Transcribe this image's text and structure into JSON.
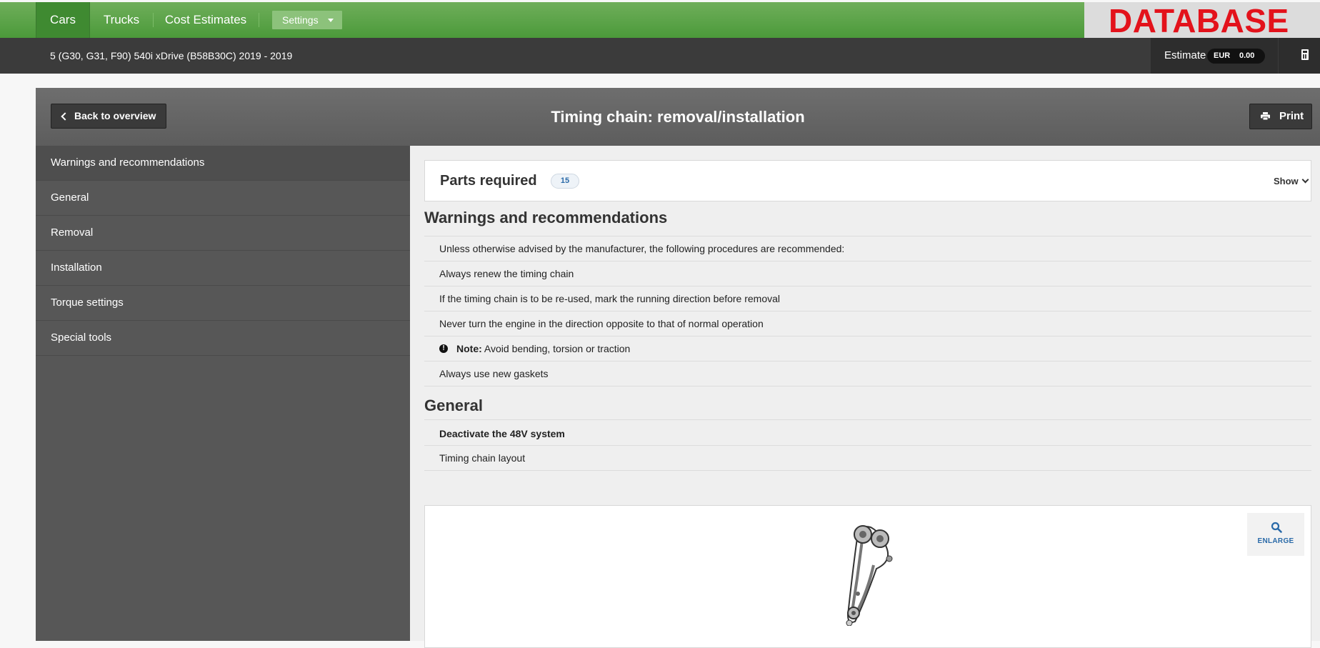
{
  "top_nav": {
    "tabs": [
      {
        "label": "Cars",
        "active": true
      },
      {
        "label": "Trucks",
        "active": false
      },
      {
        "label": "Cost Estimates",
        "active": false
      }
    ],
    "settings_label": "Settings",
    "logo_text": "DATABASE"
  },
  "vehicle_bar": {
    "vehicle": "5 (G30, G31, F90) 540i xDrive (B58B30C) 2019 - 2019",
    "estimate_label": "Estimate",
    "currency": "EUR",
    "amount": "0.00",
    "calculator_icon": "calculator-icon"
  },
  "header": {
    "back_label": "Back to overview",
    "title": "Timing chain: removal/installation",
    "print_label": "Print"
  },
  "sidebar": {
    "items": [
      {
        "label": "Warnings and recommendations"
      },
      {
        "label": "General"
      },
      {
        "label": "Removal"
      },
      {
        "label": "Installation"
      },
      {
        "label": "Torque settings"
      },
      {
        "label": "Special tools"
      }
    ]
  },
  "parts": {
    "title": "Parts required",
    "count": "15",
    "toggle_label": "Show"
  },
  "warnings": {
    "title": "Warnings and recommendations",
    "intro": "Unless otherwise advised by the manufacturer, the following procedures are recommended:",
    "items": [
      "Always renew the timing chain",
      "If the timing chain is to be re-used, mark the running direction before removal",
      "Never turn the engine in the direction opposite to that of normal operation"
    ],
    "note_label": "Note:",
    "note_text": "Avoid bending, torsion or traction",
    "last_item": "Always use new gaskets"
  },
  "general": {
    "title": "General",
    "items": [
      "Deactivate the 48V system",
      "Timing chain layout"
    ],
    "enlarge_label": "ENLARGE"
  },
  "colors": {
    "nav_green": "#4b9a3a",
    "logo_red": "#e3121b",
    "dark_bar": "#3b3b3b",
    "sidebar": "#575757",
    "link_blue": "#2a6aa8"
  }
}
